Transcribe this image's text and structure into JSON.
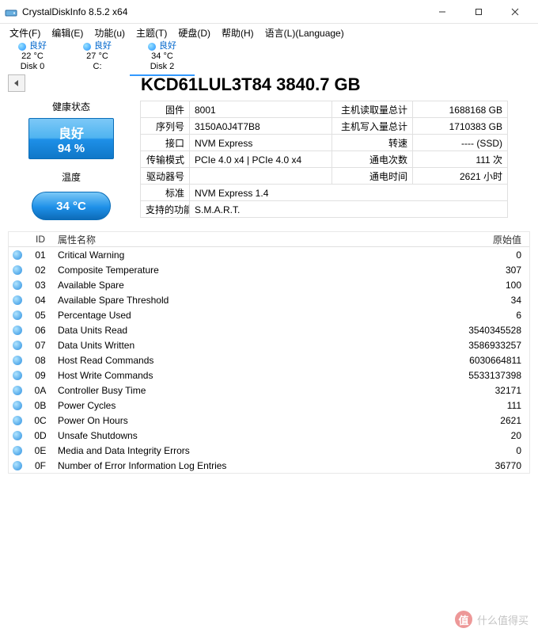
{
  "window": {
    "title": "CrystalDiskInfo 8.5.2 x64"
  },
  "menu": {
    "file": "文件(F)",
    "edit": "编辑(E)",
    "function": "功能(u)",
    "theme": "主题(T)",
    "disk": "硬盘(D)",
    "help": "帮助(H)",
    "language": "语言(L)(Language)"
  },
  "tabs": [
    {
      "status": "良好",
      "temp": "22 °C",
      "name": "Disk 0"
    },
    {
      "status": "良好",
      "temp": "27 °C",
      "name": "C:"
    },
    {
      "status": "良好",
      "temp": "34 °C",
      "name": "Disk 2"
    }
  ],
  "left": {
    "health_label": "健康状态",
    "health_status": "良好",
    "health_percent": "94 %",
    "temp_label": "温度",
    "temp_value": "34 °C"
  },
  "model": "KCD61LUL3T84 3840.7 GB",
  "info": {
    "firmware_lbl": "固件",
    "firmware_val": "8001",
    "serial_lbl": "序列号",
    "serial_val": "3150A0J4T7B8",
    "interface_lbl": "接口",
    "interface_val": "NVM Express",
    "transfer_lbl": "传输模式",
    "transfer_val": "PCIe 4.0 x4 | PCIe 4.0 x4",
    "drive_letter_lbl": "驱动器号",
    "drive_letter_val": "",
    "standard_lbl": "标准",
    "standard_val": "NVM Express 1.4",
    "features_lbl": "支持的功能",
    "features_val": "S.M.A.R.T.",
    "host_reads_lbl": "主机读取量总计",
    "host_reads_val": "1688168 GB",
    "host_writes_lbl": "主机写入量总计",
    "host_writes_val": "1710383 GB",
    "rpm_lbl": "转速",
    "rpm_val": "---- (SSD)",
    "power_count_lbl": "通电次数",
    "power_count_val": "111 次",
    "power_hours_lbl": "通电时间",
    "power_hours_val": "2621 小时"
  },
  "smart": {
    "header_id": "ID",
    "header_name": "属性名称",
    "header_raw": "原始值",
    "rows": [
      {
        "id": "01",
        "name": "Critical Warning",
        "raw": "0"
      },
      {
        "id": "02",
        "name": "Composite Temperature",
        "raw": "307"
      },
      {
        "id": "03",
        "name": "Available Spare",
        "raw": "100"
      },
      {
        "id": "04",
        "name": "Available Spare Threshold",
        "raw": "34"
      },
      {
        "id": "05",
        "name": "Percentage Used",
        "raw": "6"
      },
      {
        "id": "06",
        "name": "Data Units Read",
        "raw": "3540345528"
      },
      {
        "id": "07",
        "name": "Data Units Written",
        "raw": "3586933257"
      },
      {
        "id": "08",
        "name": "Host Read Commands",
        "raw": "6030664811"
      },
      {
        "id": "09",
        "name": "Host Write Commands",
        "raw": "5533137398"
      },
      {
        "id": "0A",
        "name": "Controller Busy Time",
        "raw": "32171"
      },
      {
        "id": "0B",
        "name": "Power Cycles",
        "raw": "111"
      },
      {
        "id": "0C",
        "name": "Power On Hours",
        "raw": "2621"
      },
      {
        "id": "0D",
        "name": "Unsafe Shutdowns",
        "raw": "20"
      },
      {
        "id": "0E",
        "name": "Media and Data Integrity Errors",
        "raw": "0"
      },
      {
        "id": "0F",
        "name": "Number of Error Information Log Entries",
        "raw": "36770"
      }
    ]
  },
  "watermark": {
    "char": "值",
    "text": "什么值得买"
  }
}
